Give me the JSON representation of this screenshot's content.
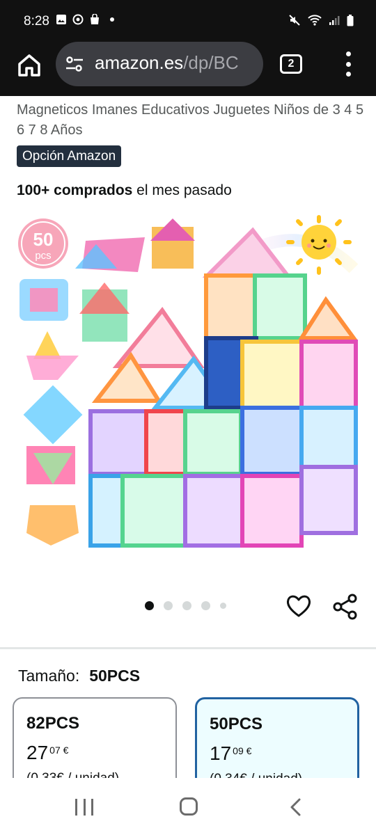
{
  "status_bar": {
    "time": "8:28",
    "left_icons": [
      "gallery-icon",
      "whatsapp-icon",
      "shopping-bag-icon",
      "notification-dot-icon"
    ],
    "right_icons": [
      "mute-icon",
      "wifi-icon",
      "signal-icon",
      "battery-icon"
    ]
  },
  "browser": {
    "url_host": "amazon.es",
    "url_path": "/dp/BC",
    "tab_count": "2"
  },
  "product": {
    "title": "Magneticos Imanes Educativos Juguetes Niños de 3 4 5 6 7 8 Años",
    "badge": "Opción Amazon",
    "bought_bold": "100+ comprados",
    "bought_rest": " el mes pasado",
    "image_badge_number": "50",
    "image_badge_unit": "pcs",
    "carousel_count": 5,
    "carousel_active_index": 0
  },
  "options": {
    "label": "Tamaño:",
    "selected_value": "50PCS",
    "cards": [
      {
        "name": "82PCS",
        "price_int": "27",
        "price_dec": "07 €",
        "unit": "(0,33€ / unidad)",
        "selected": false
      },
      {
        "name": "50PCS",
        "price_int": "17",
        "price_dec": "09 €",
        "unit": "(0,34€ / unidad)",
        "selected": true
      }
    ]
  },
  "colors": {
    "status_bg": "#111111",
    "url_pill": "#3c3d42",
    "badge_bg": "#232f3e",
    "selected_border": "#2162a1",
    "selected_bg": "#edfdff"
  }
}
